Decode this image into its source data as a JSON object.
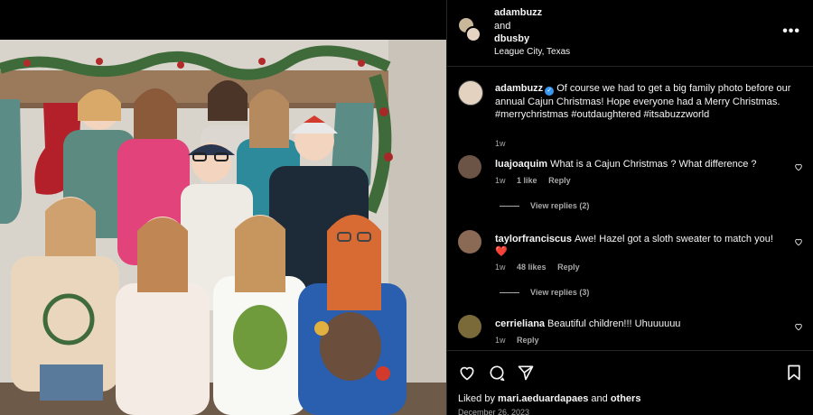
{
  "header": {
    "user1": "adambuzz",
    "and_text": "and",
    "user2": "dbusby",
    "location": "League City, Texas",
    "more_label": "•••"
  },
  "caption": {
    "username": "adambuzz",
    "verified_mark": "✓",
    "text": "Of course we had to get a big family photo before our annual Cajun Christmas! Hope everyone had a Merry Christmas. #merrychristmas #outdaughtered #itsabuzzworld",
    "time": "1w"
  },
  "comments": [
    {
      "username": "luajoaquim",
      "text": "What is a Cajun Christmas ? What difference ?",
      "time": "1w",
      "likes": "1 like",
      "reply_label": "Reply",
      "view_replies": "View replies (2)",
      "avatar_color": "#6b5346"
    },
    {
      "username": "taylorfranciscus",
      "text": "Awe! Hazel got a sloth sweater to match you!",
      "emoji": "❤️",
      "time": "1w",
      "likes": "48 likes",
      "reply_label": "Reply",
      "view_replies": "View replies (3)",
      "avatar_color": "#8a6a55"
    },
    {
      "username": "cerrieliana",
      "text": "Beautiful children!!! Uhuuuuuu",
      "time": "1w",
      "reply_label": "Reply",
      "avatar_color": "#7a6a3a"
    }
  ],
  "footer": {
    "liked_by_prefix": "Liked by",
    "liked_by_user": "mari.aeduardapaes",
    "liked_by_and": "and",
    "liked_by_others": "others",
    "date": "December 26, 2023"
  },
  "icons": {
    "like": "heart-icon",
    "comment": "comment-icon",
    "share": "share-icon",
    "save": "bookmark-icon"
  },
  "colors": {
    "background": "#000000",
    "divider": "#262626",
    "muted_text": "#a8a8a8",
    "verified": "#3897f0",
    "heart_red": "#ed4956"
  }
}
